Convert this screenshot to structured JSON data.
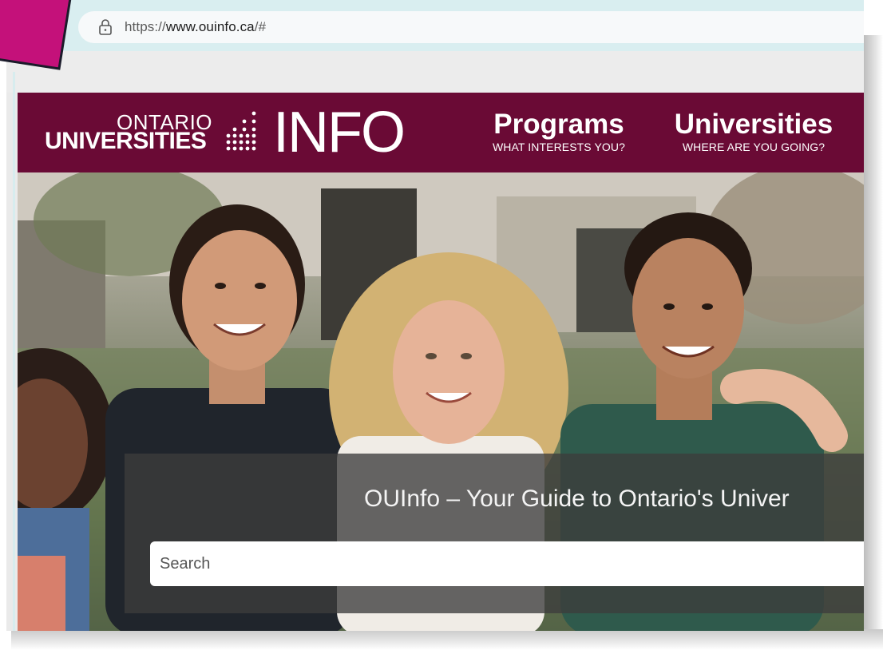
{
  "browser": {
    "url_prefix": "https://",
    "url_host": "www.ouinfo.ca",
    "url_suffix": "/#"
  },
  "header": {
    "logo_ontario": "ONTARIO",
    "logo_universities": "UNIVERSITIES",
    "logo_info": "INFO",
    "nav": [
      {
        "title": "Programs",
        "subtitle": "WHAT INTERESTS YOU?"
      },
      {
        "title": "Universities",
        "subtitle": "WHERE ARE YOU GOING?"
      }
    ]
  },
  "hero": {
    "tagline": "OUInfo – Your Guide to Ontario's Univer",
    "search_placeholder": "Search"
  },
  "colors": {
    "header_bg": "#6a0a35",
    "chrome_bg": "#d9eef0",
    "callout": "#c4117a"
  },
  "icons": {
    "lock": "lock-icon",
    "logo_mark": "dot-grid-logo"
  }
}
